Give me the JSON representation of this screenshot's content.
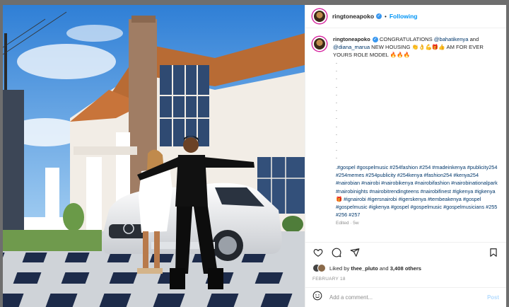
{
  "post": {
    "username": "ringtoneapoko",
    "follow_label": "Following",
    "separator": "•",
    "caption_parts": {
      "username": "ringtoneapoko",
      "text1": " CONGRATULATIONS ",
      "mention1": "@bahatikenya",
      "text2": " and ",
      "mention2": "@diana_marua",
      "text3": " NEW HOUSING 👏👌💪🎁👍 AM FOR EVER YOURS ROLE MODEL 🔥🔥🔥"
    },
    "dots": [
      ".",
      ".",
      ".",
      ".",
      ".",
      ".",
      ".",
      ".",
      ".",
      ".",
      ".",
      ".",
      "."
    ],
    "hashtags": ".#gospel #gospelmusic #254fashion #254 #madeinkenya #publicity254 #254memes #254publicity #254kenya #fashion254 #kenya254 #nairobian #nairobi #nairobikenya #nairobifashion #nairobinationalpark #nairobinights #nairobitrendingteens #nairobifinest #igkenya #igkenya🎁 #ignairobi #igersnairobi #igerskenya #tembeakenya #gospel #gospelmusic #igkenya #gospel #gospelmusic #gospelmusicians #255 #256 #257",
    "edited": "Edited · 5w",
    "likes": {
      "prefix": "Liked by ",
      "user": "thee_pluto",
      "middle": " and ",
      "count": "3,408 others"
    },
    "date": "FEBRUARY 18",
    "comment_placeholder": "Add a comment...",
    "post_label": "Post"
  },
  "colors": {
    "link": "#0095f6",
    "mention": "#00376b",
    "muted": "#8e8e8e",
    "post_disabled": "#b3dbff"
  },
  "icons": [
    "heart-icon",
    "comment-icon",
    "share-icon",
    "bookmark-icon",
    "emoji-icon",
    "verified-icon"
  ]
}
